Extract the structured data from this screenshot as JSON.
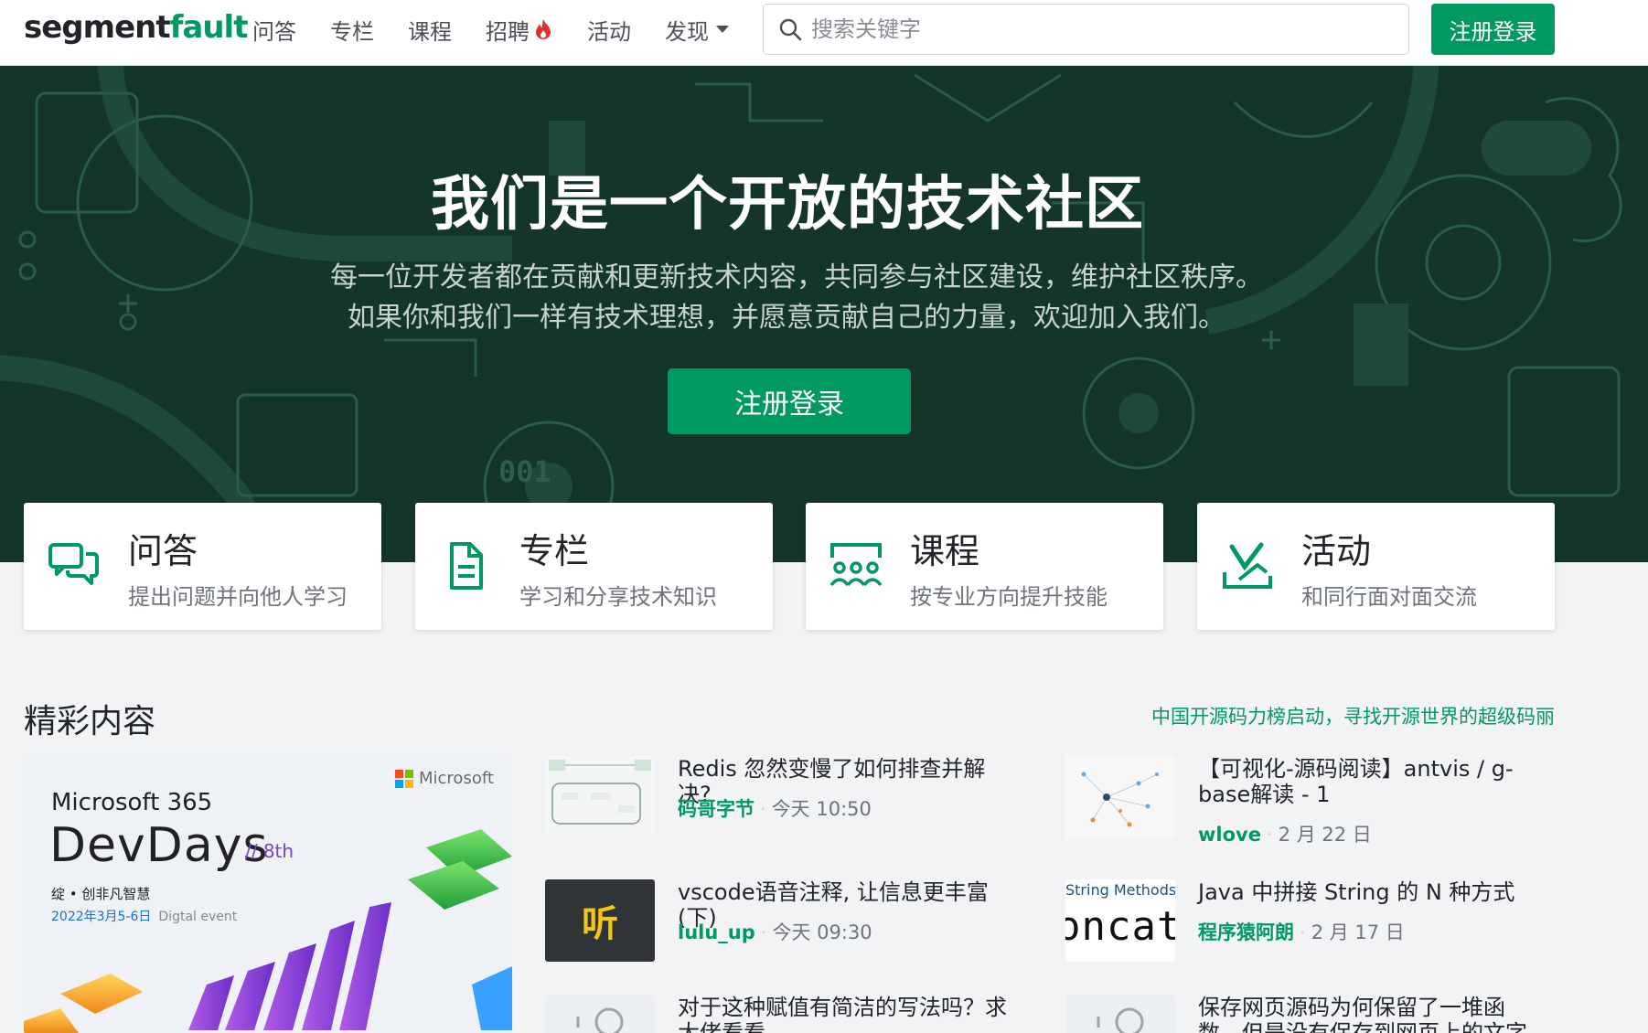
{
  "nav": {
    "logo_a": "segment",
    "logo_b": "fault",
    "items": [
      {
        "label": "问答"
      },
      {
        "label": "专栏"
      },
      {
        "label": "课程"
      },
      {
        "label": "招聘"
      },
      {
        "label": "活动"
      },
      {
        "label": "发现"
      }
    ],
    "search_placeholder": "搜索关键字",
    "login_label": "注册登录"
  },
  "hero": {
    "title": "我们是一个开放的技术社区",
    "subtitle_line1": "每一位开发者都在贡献和更新技术内容，共同参与社区建设，维护社区秩序。",
    "subtitle_line2": "如果你和我们一样有技术理想，并愿意贡献自己的力量，欢迎加入我们。",
    "button": "注册登录",
    "decor_text": "001"
  },
  "cards": [
    {
      "title": "问答",
      "desc": "提出问题并向他人学习",
      "icon": "chat-bubbles-icon"
    },
    {
      "title": "专栏",
      "desc": "学习和分享技术知识",
      "icon": "document-icon"
    },
    {
      "title": "课程",
      "desc": "按专业方向提升技能",
      "icon": "classroom-icon"
    },
    {
      "title": "活动",
      "desc": "和同行面对面交流",
      "icon": "event-icon"
    }
  ],
  "featured": {
    "title": "精彩内容",
    "link": "中国开源码力榜启动，寻找开源世界的超级码丽",
    "promo": {
      "brand": "Microsoft",
      "product": "Microsoft 365",
      "event": "DevDays",
      "edition": "// 8th",
      "tagline": "绽 • 创非凡智慧",
      "date": "2022年3月5-6日",
      "date_note": "Digtal event"
    },
    "articles": [
      {
        "title": "Redis 忽然变慢了如何排查并解决?",
        "author": "码哥字节",
        "time": "今天 10:50",
        "thumb": "diagram-thumb"
      },
      {
        "title": "【可视化-源码阅读】antvis / g-base解读 - 1",
        "author": "wlove",
        "time": "2 月 22 日",
        "thumb": "graph-thumb"
      },
      {
        "title": "vscode语音注释, 让信息更丰富(下)",
        "author": "lulu_up",
        "time": "今天 09:30",
        "thumb": "listen-thumb",
        "thumb_text": "听"
      },
      {
        "title": "Java 中拼接 String 的 N 种方式",
        "author": "程序猿阿朗",
        "time": "2 月 17 日",
        "thumb": "string-thumb",
        "thumb_top": "String Methods",
        "thumb_big": "oncat"
      },
      {
        "title": "对于这种赋值有简洁的写法吗？求大佬看看",
        "author": "",
        "time": "",
        "thumb": "default-thumb"
      },
      {
        "title": "保存网页源码为何保留了一堆函数，但是没有保存到网页上的文字呢？",
        "author": "",
        "time": "",
        "thumb": "default-thumb"
      }
    ]
  },
  "colors": {
    "brand": "#009a61",
    "hero_bg": "#14352a",
    "page_bg": "#f1f3f5"
  }
}
